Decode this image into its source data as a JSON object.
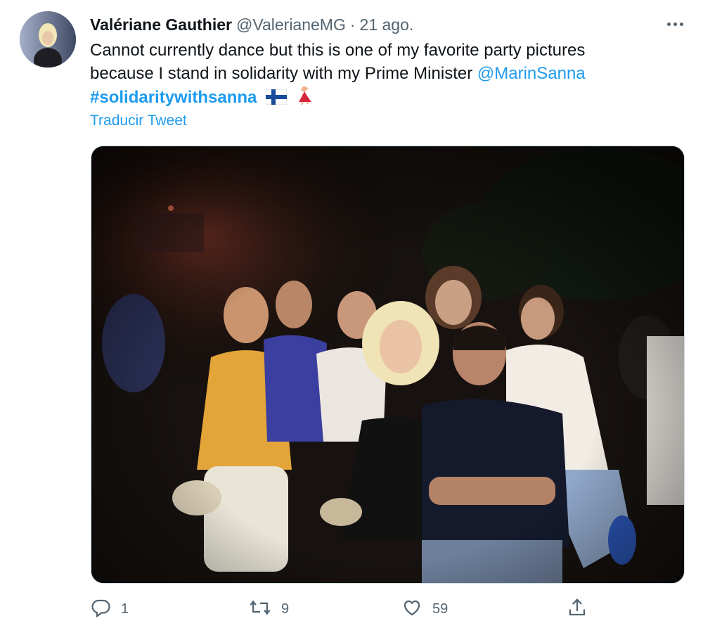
{
  "tweet": {
    "author_name": "Valériane Gauthier",
    "author_handle": "@ValerianeMG",
    "separator": "·",
    "date": "21 ago.",
    "text_line1": "Cannot currently dance but this is one of my favorite party pictures",
    "text_line2": "because I stand in solidarity with my Prime Minister",
    "mention": "@MarinSanna",
    "hashtag": "#solidaritywithsanna",
    "emojis": [
      "finland-flag",
      "dancer"
    ],
    "translate_label": "Traducir Tweet"
  },
  "actions": {
    "reply_count": "1",
    "retweet_count": "9",
    "like_count": "59"
  },
  "icons": [
    "more-icon",
    "reply-icon",
    "retweet-icon",
    "like-icon",
    "share-icon"
  ],
  "colors": {
    "link": "#1d9bf0",
    "text": "#0f1419",
    "secondary": "#536471"
  }
}
